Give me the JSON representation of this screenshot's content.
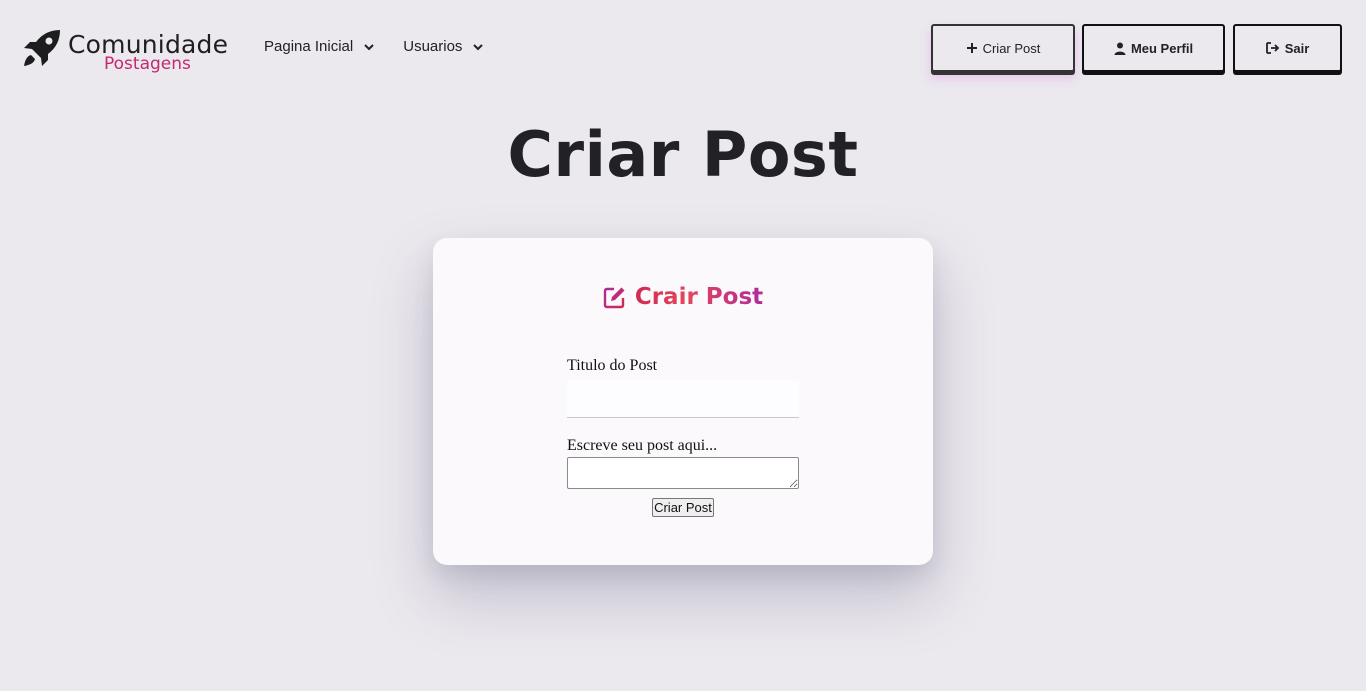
{
  "logo": {
    "title": "Comunidade",
    "subtitle": "Postagens",
    "icon": "rocket-icon"
  },
  "nav": {
    "items": [
      {
        "label": "Pagina Inicial",
        "icon": "chevron-down-icon"
      },
      {
        "label": "Usuarios",
        "icon": "chevron-down-icon"
      }
    ]
  },
  "actions": {
    "create_post": {
      "label": "Criar Post",
      "icon": "plus-icon"
    },
    "profile": {
      "label": "Meu Perfil",
      "icon": "user-icon"
    },
    "logout": {
      "label": "Sair",
      "icon": "sign-out-icon"
    }
  },
  "page": {
    "title": "Criar Post"
  },
  "form": {
    "heading": "Crair Post",
    "heading_icon": "edit-icon",
    "title_label": "Titulo do Post",
    "title_value": "",
    "body_label": "Escreve seu post aqui...",
    "body_value": "",
    "submit_label": "Criar Post"
  },
  "colors": {
    "background": "#ebe8ee",
    "card": "#fbf9fc",
    "accent_pink": "#c4286e",
    "accent_red": "#cf2a54",
    "accent_purple": "#b02a9a"
  }
}
